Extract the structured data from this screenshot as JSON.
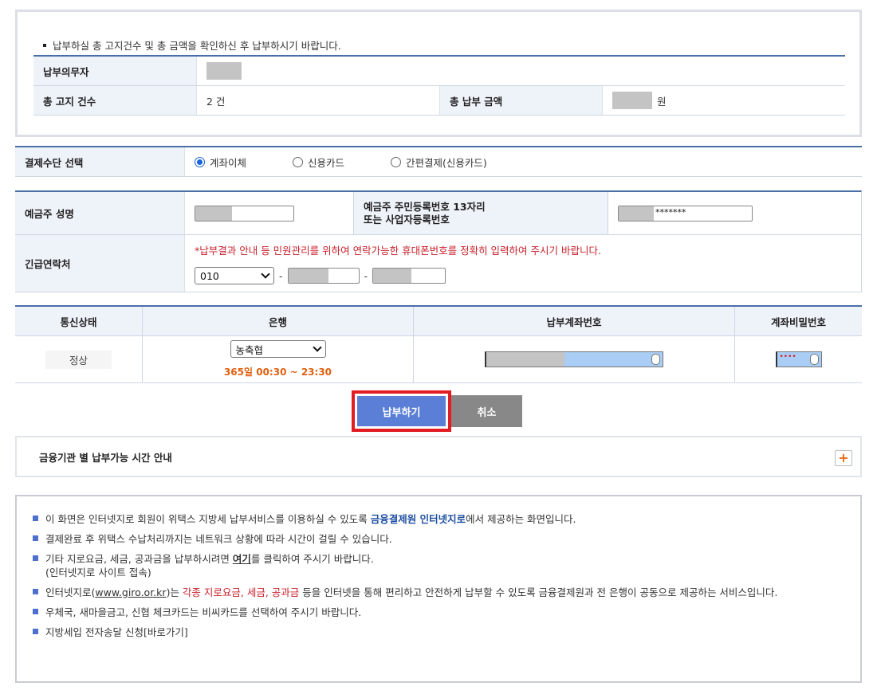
{
  "summary": {
    "note": "납부하실 총 고지건수 및 총 금액을 확인하신 후 납부하시기 바랍니다.",
    "obligor_label": "납부의무자",
    "count_label": "총 고지 건수",
    "count_value": "2 건",
    "amount_label": "총 납부 금액",
    "amount_unit": "원"
  },
  "payment_method": {
    "label": "결제수단 선택",
    "options": [
      "계좌이체",
      "신용카드",
      "간편결제(신용카드)"
    ],
    "selected": "계좌이체"
  },
  "depositor": {
    "name_label": "예금주 성명",
    "id_label_line1": "예금주 주민등록번호 13자리",
    "id_label_line2": "또는 사업자등록번호",
    "id_masked_suffix": "*******",
    "phone_label": "긴급연락처",
    "phone_notice": "*납부결과 안내 등 민원관리를 위하여 연락가능한 휴대폰번호를 정확히 입력하여 주시기 바랍니다.",
    "phone_prefix": "010",
    "dash": "-"
  },
  "bank_table": {
    "headers": [
      "통신상태",
      "은행",
      "납부계좌번호",
      "계좌비밀번호"
    ],
    "status": "정상",
    "bank_selected": "농축협",
    "hours": "365일 00:30 ~ 23:30",
    "password_dots": "••••"
  },
  "buttons": {
    "pay": "납부하기",
    "cancel": "취소"
  },
  "time_guide": {
    "label": "금융기관 별 납부가능 시간 안내",
    "expand": "+"
  },
  "info": {
    "i1_a": "이 화면은 인터넷지로 회원이 위택스 지방세 납부서비스를 이용하실 수 있도록 ",
    "i1_b": "금융결제원 인터넷지로",
    "i1_c": "에서 제공하는 화면입니다.",
    "i2": "결제완료 후 위택스 수납처리까지는 네트워크 상황에 따라 시간이 걸릴 수 있습니다.",
    "i3_a": "기타 지로요금, 세금, 공과금을 납부하시려면 ",
    "i3_b": "여기",
    "i3_c": "를 클릭하여 주시기 바랍니다.",
    "i3_d": "(인터넷지로 사이트 접속)",
    "i4_a": "인터넷지로(",
    "i4_b": "www.giro.or.kr",
    "i4_c": ")는 ",
    "i4_d": "각종 지로요금, 세금, 공과금",
    "i4_e": " 등을 인터넷을 통해 편리하고 안전하게 납부할 수 있도록 금융결제원과 전 은행이 공동으로 제공하는 서비스입니다.",
    "i5": "우체국, 새마을금고, 신협 체크카드는 비씨카드를 선택하여 주시기 바랍니다.",
    "i6": "지방세입 전자송달 신청[바로가기]"
  },
  "colors": {
    "accent_blue": "#4a6fa8",
    "header_bg": "#eef2f9",
    "pay_button": "#5b7fd6",
    "highlight_red": "#e31b23",
    "notice_red": "#c8202b",
    "hours_orange": "#e0600f"
  }
}
